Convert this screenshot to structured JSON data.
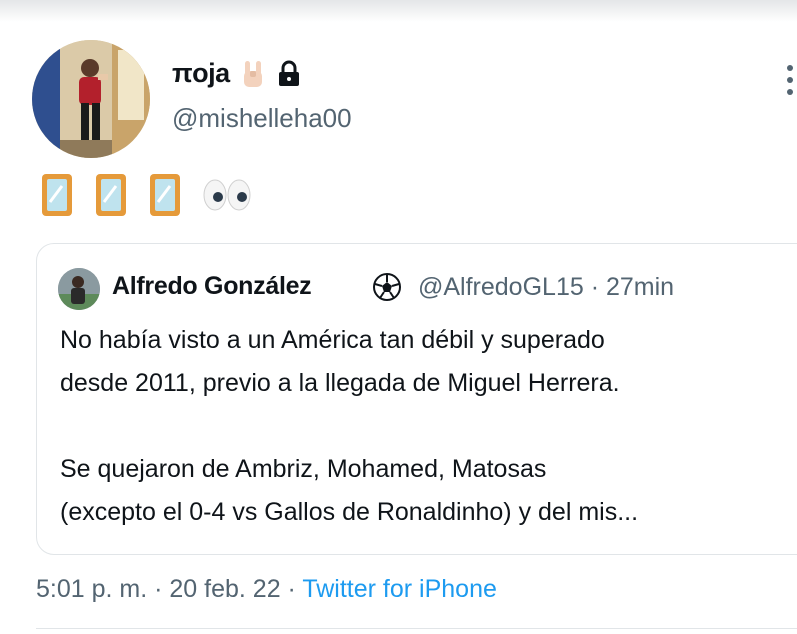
{
  "tweet": {
    "author": {
      "display_name": "πoja",
      "handle": "@mishelleha00",
      "name_emojis": [
        "rock-hand-emoji",
        "lock-emoji"
      ]
    },
    "text_emojis": [
      "mirror-emoji",
      "mirror-emoji",
      "mirror-emoji",
      "eyes-emoji"
    ],
    "quoted": {
      "author_name": "Alfredo González",
      "author_emoji": "soccer-ball-emoji",
      "author_handle": "@AlfredoGL15",
      "separator": "·",
      "time_ago": "27min",
      "paragraphs": [
        [
          "No había visto a un América tan débil y superado",
          "desde 2011, previo a la llegada de Miguel Herrera."
        ],
        [
          "Se quejaron de Ambriz, Mohamed, Matosas",
          "(excepto el 0-4 vs Gallos de Ronaldinho) y del mis..."
        ]
      ]
    },
    "timestamp": "5:01 p. m. · 20 feb. 22 · ",
    "source": "Twitter for iPhone"
  }
}
